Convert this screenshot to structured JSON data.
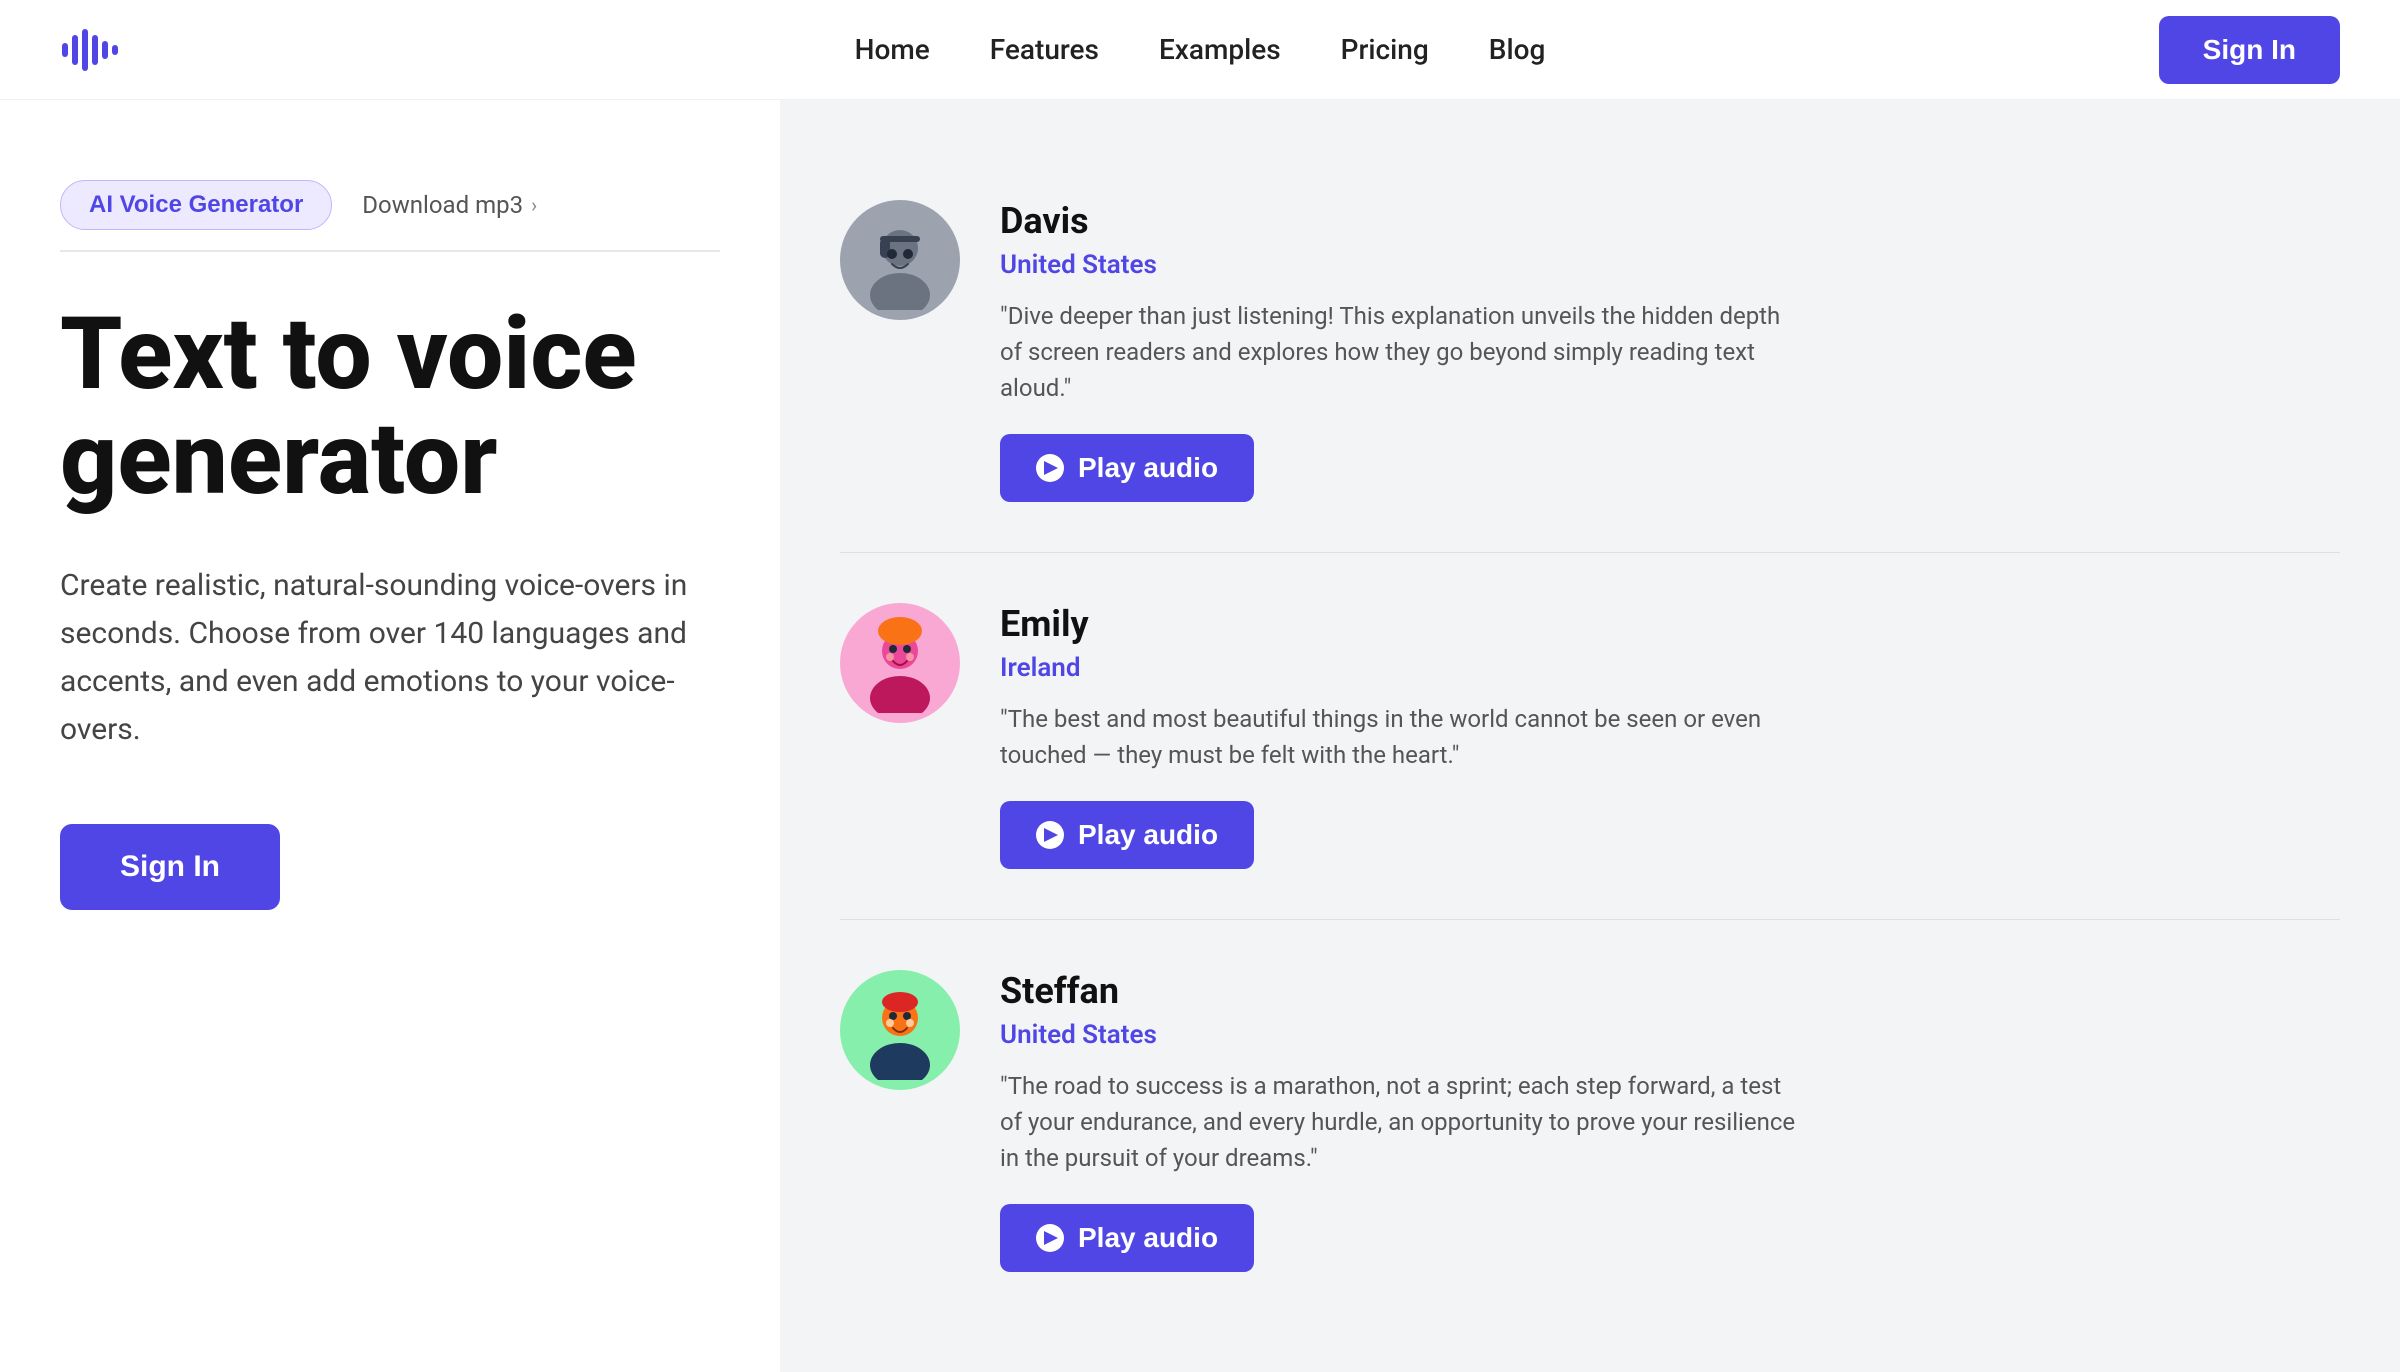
{
  "header": {
    "logo_alt": "AI Voice Generator Logo",
    "nav": [
      {
        "label": "Home",
        "id": "nav-home"
      },
      {
        "label": "Features",
        "id": "nav-features"
      },
      {
        "label": "Examples",
        "id": "nav-examples"
      },
      {
        "label": "Pricing",
        "id": "nav-pricing"
      },
      {
        "label": "Blog",
        "id": "nav-blog"
      }
    ],
    "sign_in_label": "Sign In"
  },
  "hero": {
    "tab_active": "AI Voice Generator",
    "tab_inactive": "Download mp3",
    "title_line1": "Text to voice",
    "title_line2": "generator",
    "subtitle": "Create realistic, natural-sounding voice-overs in seconds. Choose from over 140 languages and accents, and even add emotions to your voice-overs.",
    "sign_in_label": "Sign In"
  },
  "voices": [
    {
      "id": "davis",
      "name": "Davis",
      "country": "United States",
      "quote": "\"Dive deeper than just listening! This explanation unveils the hidden depth of screen readers and explores how they go beyond simply reading text aloud.\"",
      "play_label": "Play audio",
      "avatar_emoji": "🎧"
    },
    {
      "id": "emily",
      "name": "Emily",
      "country": "Ireland",
      "quote": "\"The best and most beautiful things in the world cannot be seen or even touched — they must be felt with the heart.\"",
      "play_label": "Play audio",
      "avatar_emoji": "😄"
    },
    {
      "id": "steffan",
      "name": "Steffan",
      "country": "United States",
      "quote": "\"The road to success is a marathon, not a sprint; each step forward, a test of your endurance, and every hurdle, an opportunity to prove your resilience in the pursuit of your dreams.\"",
      "play_label": "Play audio",
      "avatar_emoji": "😊"
    }
  ],
  "colors": {
    "primary": "#4f46e5",
    "primary_light": "#ede9fe",
    "primary_border": "#c4b5fd",
    "text_dark": "#111111",
    "text_medium": "#444444",
    "text_light": "#888888",
    "background_right": "#f3f4f6"
  }
}
